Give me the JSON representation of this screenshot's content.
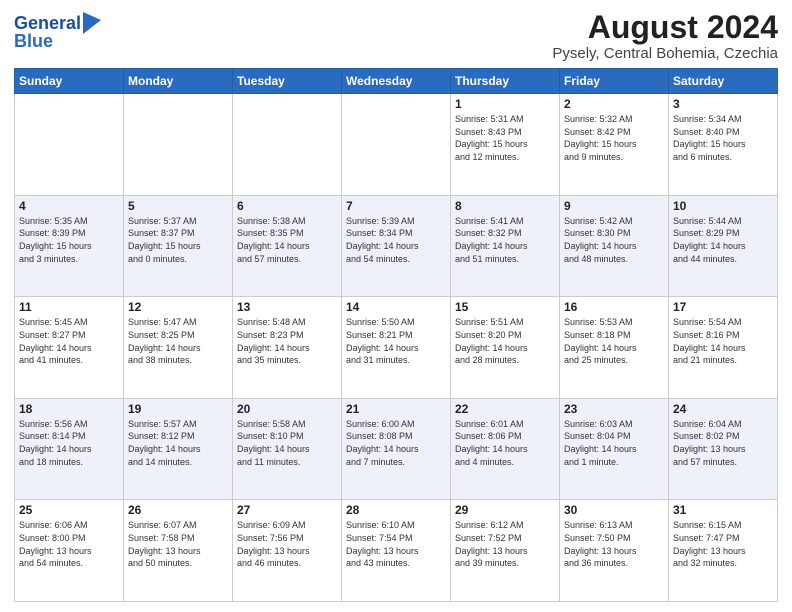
{
  "header": {
    "logo_line1": "General",
    "logo_line2": "Blue",
    "main_title": "August 2024",
    "subtitle": "Pysely, Central Bohemia, Czechia"
  },
  "calendar": {
    "headers": [
      "Sunday",
      "Monday",
      "Tuesday",
      "Wednesday",
      "Thursday",
      "Friday",
      "Saturday"
    ],
    "rows": [
      [
        {
          "day": "",
          "info": ""
        },
        {
          "day": "",
          "info": ""
        },
        {
          "day": "",
          "info": ""
        },
        {
          "day": "",
          "info": ""
        },
        {
          "day": "1",
          "info": "Sunrise: 5:31 AM\nSunset: 8:43 PM\nDaylight: 15 hours\nand 12 minutes."
        },
        {
          "day": "2",
          "info": "Sunrise: 5:32 AM\nSunset: 8:42 PM\nDaylight: 15 hours\nand 9 minutes."
        },
        {
          "day": "3",
          "info": "Sunrise: 5:34 AM\nSunset: 8:40 PM\nDaylight: 15 hours\nand 6 minutes."
        }
      ],
      [
        {
          "day": "4",
          "info": "Sunrise: 5:35 AM\nSunset: 8:39 PM\nDaylight: 15 hours\nand 3 minutes."
        },
        {
          "day": "5",
          "info": "Sunrise: 5:37 AM\nSunset: 8:37 PM\nDaylight: 15 hours\nand 0 minutes."
        },
        {
          "day": "6",
          "info": "Sunrise: 5:38 AM\nSunset: 8:35 PM\nDaylight: 14 hours\nand 57 minutes."
        },
        {
          "day": "7",
          "info": "Sunrise: 5:39 AM\nSunset: 8:34 PM\nDaylight: 14 hours\nand 54 minutes."
        },
        {
          "day": "8",
          "info": "Sunrise: 5:41 AM\nSunset: 8:32 PM\nDaylight: 14 hours\nand 51 minutes."
        },
        {
          "day": "9",
          "info": "Sunrise: 5:42 AM\nSunset: 8:30 PM\nDaylight: 14 hours\nand 48 minutes."
        },
        {
          "day": "10",
          "info": "Sunrise: 5:44 AM\nSunset: 8:29 PM\nDaylight: 14 hours\nand 44 minutes."
        }
      ],
      [
        {
          "day": "11",
          "info": "Sunrise: 5:45 AM\nSunset: 8:27 PM\nDaylight: 14 hours\nand 41 minutes."
        },
        {
          "day": "12",
          "info": "Sunrise: 5:47 AM\nSunset: 8:25 PM\nDaylight: 14 hours\nand 38 minutes."
        },
        {
          "day": "13",
          "info": "Sunrise: 5:48 AM\nSunset: 8:23 PM\nDaylight: 14 hours\nand 35 minutes."
        },
        {
          "day": "14",
          "info": "Sunrise: 5:50 AM\nSunset: 8:21 PM\nDaylight: 14 hours\nand 31 minutes."
        },
        {
          "day": "15",
          "info": "Sunrise: 5:51 AM\nSunset: 8:20 PM\nDaylight: 14 hours\nand 28 minutes."
        },
        {
          "day": "16",
          "info": "Sunrise: 5:53 AM\nSunset: 8:18 PM\nDaylight: 14 hours\nand 25 minutes."
        },
        {
          "day": "17",
          "info": "Sunrise: 5:54 AM\nSunset: 8:16 PM\nDaylight: 14 hours\nand 21 minutes."
        }
      ],
      [
        {
          "day": "18",
          "info": "Sunrise: 5:56 AM\nSunset: 8:14 PM\nDaylight: 14 hours\nand 18 minutes."
        },
        {
          "day": "19",
          "info": "Sunrise: 5:57 AM\nSunset: 8:12 PM\nDaylight: 14 hours\nand 14 minutes."
        },
        {
          "day": "20",
          "info": "Sunrise: 5:58 AM\nSunset: 8:10 PM\nDaylight: 14 hours\nand 11 minutes."
        },
        {
          "day": "21",
          "info": "Sunrise: 6:00 AM\nSunset: 8:08 PM\nDaylight: 14 hours\nand 7 minutes."
        },
        {
          "day": "22",
          "info": "Sunrise: 6:01 AM\nSunset: 8:06 PM\nDaylight: 14 hours\nand 4 minutes."
        },
        {
          "day": "23",
          "info": "Sunrise: 6:03 AM\nSunset: 8:04 PM\nDaylight: 14 hours\nand 1 minute."
        },
        {
          "day": "24",
          "info": "Sunrise: 6:04 AM\nSunset: 8:02 PM\nDaylight: 13 hours\nand 57 minutes."
        }
      ],
      [
        {
          "day": "25",
          "info": "Sunrise: 6:06 AM\nSunset: 8:00 PM\nDaylight: 13 hours\nand 54 minutes."
        },
        {
          "day": "26",
          "info": "Sunrise: 6:07 AM\nSunset: 7:58 PM\nDaylight: 13 hours\nand 50 minutes."
        },
        {
          "day": "27",
          "info": "Sunrise: 6:09 AM\nSunset: 7:56 PM\nDaylight: 13 hours\nand 46 minutes."
        },
        {
          "day": "28",
          "info": "Sunrise: 6:10 AM\nSunset: 7:54 PM\nDaylight: 13 hours\nand 43 minutes."
        },
        {
          "day": "29",
          "info": "Sunrise: 6:12 AM\nSunset: 7:52 PM\nDaylight: 13 hours\nand 39 minutes."
        },
        {
          "day": "30",
          "info": "Sunrise: 6:13 AM\nSunset: 7:50 PM\nDaylight: 13 hours\nand 36 minutes."
        },
        {
          "day": "31",
          "info": "Sunrise: 6:15 AM\nSunset: 7:47 PM\nDaylight: 13 hours\nand 32 minutes."
        }
      ]
    ]
  }
}
